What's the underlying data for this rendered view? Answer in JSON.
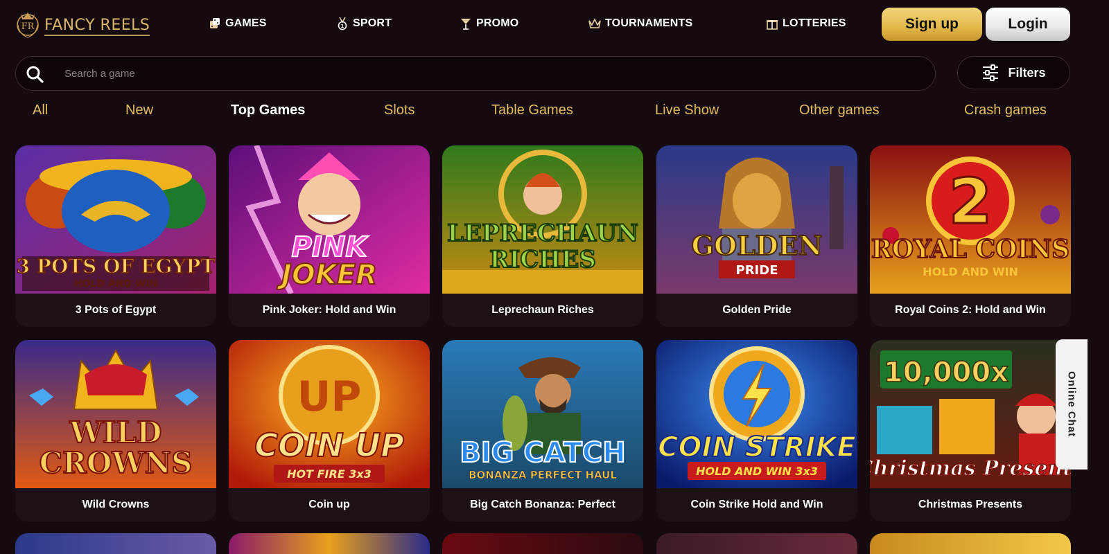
{
  "brand": {
    "name": "FANCY REELS"
  },
  "nav": [
    {
      "label": "GAMES",
      "icon": "dice-icon"
    },
    {
      "label": "SPORT",
      "icon": "medal-icon"
    },
    {
      "label": "PROMO",
      "icon": "cocktail-icon"
    },
    {
      "label": "TOURNAMENTS",
      "icon": "crown-icon"
    },
    {
      "label": "LOTTERIES",
      "icon": "gift-icon"
    }
  ],
  "auth": {
    "signup_label": "Sign up",
    "login_label": "Login"
  },
  "search": {
    "placeholder": "Search a game"
  },
  "filters": {
    "label": "Filters"
  },
  "categories": [
    "All",
    "New",
    "Top Games",
    "Slots",
    "Table Games",
    "Live Show",
    "Other games",
    "Crash games"
  ],
  "active_category": "Top Games",
  "games": [
    {
      "title": "3 Pots of Egypt",
      "art_lines": [
        "3 POTS OF EGYPT",
        "HOLD AND WIN"
      ]
    },
    {
      "title": "Pink Joker: Hold and Win",
      "art_lines": [
        "PINK",
        "JOKER"
      ]
    },
    {
      "title": "Leprechaun Riches",
      "art_lines": [
        "LEPRECHAUN",
        "RICHES"
      ]
    },
    {
      "title": "Golden Pride",
      "art_lines": [
        "GOLDEN",
        "PRIDE"
      ]
    },
    {
      "title": "Royal Coins 2: Hold and Win",
      "art_lines": [
        "2",
        "ROYAL COINS",
        "HOLD AND WIN"
      ]
    },
    {
      "title": "Wild Crowns",
      "art_lines": [
        "WILD",
        "CROWNS"
      ]
    },
    {
      "title": "Coin up",
      "art_lines": [
        "UP",
        "COIN UP",
        "HOT FIRE 3x3"
      ]
    },
    {
      "title": "Big Catch Bonanza: Perfect",
      "art_lines": [
        "BIG CATCH",
        "BONANZA PERFECT HAUL"
      ]
    },
    {
      "title": "Coin Strike Hold and Win",
      "art_lines": [
        "COIN STRIKE",
        "HOLD AND WIN 3x3"
      ]
    },
    {
      "title": "Christmas Presents",
      "art_lines": [
        "10,000x",
        "Christmas Presents"
      ]
    }
  ],
  "chat": {
    "label": "Online Chat"
  },
  "colors": {
    "accent_gold": "#e2bd63",
    "background": "#140a10",
    "card": "#1c1216"
  }
}
